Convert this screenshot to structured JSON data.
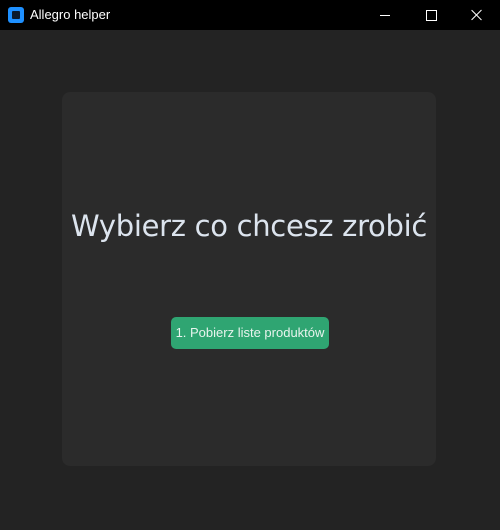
{
  "window": {
    "title": "Allegro helper",
    "controls": {
      "minimize_icon": "minimize-icon",
      "maximize_icon": "maximize-icon",
      "close_icon": "close-icon"
    }
  },
  "main": {
    "heading": "Wybierz co chcesz zrobić",
    "actions": [
      {
        "label": "1. Pobierz liste produktów"
      }
    ]
  },
  "colors": {
    "background": "#232323",
    "card": "#2b2b2b",
    "accent": "#2fa572",
    "titlebar": "#000000",
    "app_icon": "#1e90ff"
  }
}
